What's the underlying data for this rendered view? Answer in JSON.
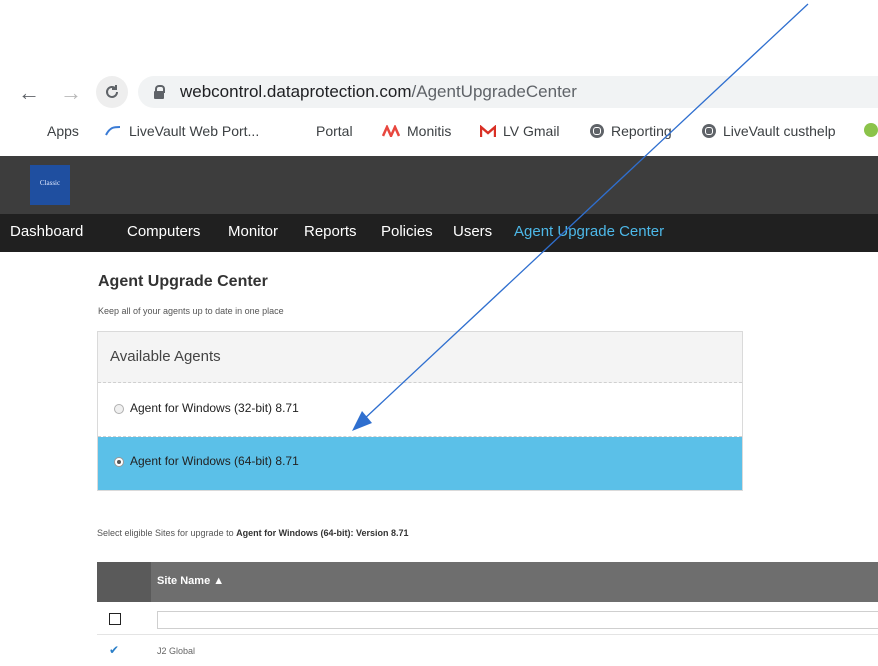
{
  "browser": {
    "url_host": "webcontrol.dataprotection.com",
    "url_path": "/AgentUpgradeCenter",
    "bookmarks": [
      {
        "label": "Apps",
        "icon": "apps-grid-icon"
      },
      {
        "label": "LiveVault Web Port...",
        "icon": "livevault-icon"
      },
      {
        "label": "Portal",
        "icon": "blank-page-icon"
      },
      {
        "label": "Monitis",
        "icon": "monitis-icon"
      },
      {
        "label": "LV Gmail",
        "icon": "gmail-icon"
      },
      {
        "label": "Reporting",
        "icon": "globe-icon"
      },
      {
        "label": "LiveVault custhelp",
        "icon": "globe-icon"
      }
    ]
  },
  "app": {
    "logo_text": "Classic",
    "nav": [
      "Dashboard",
      "Computers",
      "Monitor",
      "Reports",
      "Policies",
      "Users",
      "Agent Upgrade Center"
    ],
    "active_nav": "Agent Upgrade Center"
  },
  "page": {
    "title": "Agent Upgrade Center",
    "subtitle": "Keep all of your agents up to date in one place"
  },
  "agents_panel": {
    "header": "Available Agents",
    "options": [
      {
        "label": "Agent for Windows (32-bit) 8.71",
        "selected": false
      },
      {
        "label": "Agent for Windows (64-bit) 8.71",
        "selected": true
      }
    ]
  },
  "select_note": {
    "prefix": "Select eligible Sites for upgrade to ",
    "target": "Agent for Windows (64-bit): Version 8.71"
  },
  "sites_table": {
    "column": "Site Name ▲",
    "rows": [
      {
        "site": "J2 Global",
        "checked": true
      }
    ]
  },
  "colors": {
    "header_bg": "#3d3d3d",
    "nav_bg": "#202020",
    "active_nav": "#4db8e8",
    "selected_row": "#5bc0e8",
    "table_head": "#6e6e6e",
    "annotation_arrow": "#2f6fcf"
  }
}
